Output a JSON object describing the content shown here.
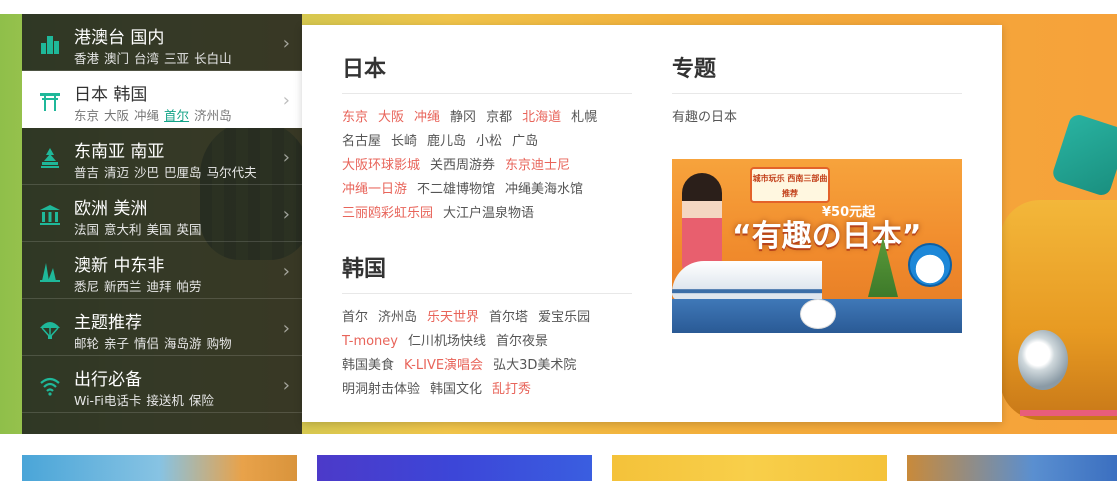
{
  "nav": {
    "items": [
      {
        "title": "港澳台 国内",
        "subs": [
          "香港",
          "澳门",
          "台湾",
          "三亚",
          "长白山"
        ]
      },
      {
        "title": "日本 韩国",
        "subs": [
          "东京",
          "大阪",
          "冲绳",
          "首尔",
          "济州岛"
        ],
        "active": true,
        "highlight": "首尔"
      },
      {
        "title": "东南亚 南亚",
        "subs": [
          "普吉",
          "清迈",
          "沙巴",
          "巴厘岛",
          "马尔代夫"
        ]
      },
      {
        "title": "欧洲 美洲",
        "subs": [
          "法国",
          "意大利",
          "美国",
          "英国"
        ]
      },
      {
        "title": "澳新 中东非",
        "subs": [
          "悉尼",
          "新西兰",
          "迪拜",
          "帕劳"
        ]
      },
      {
        "title": "主题推荐",
        "subs": [
          "邮轮",
          "亲子",
          "情侣",
          "海岛游",
          "购物"
        ]
      },
      {
        "title": "出行必备",
        "subs": [
          "Wi-Fi电话卡",
          "接送机",
          "保险"
        ]
      }
    ],
    "icons": [
      "building-icon",
      "torii-icon",
      "pagoda-icon",
      "museum-icon",
      "opera-house-icon",
      "parachute-icon",
      "wifi-icon"
    ],
    "arrow": "›"
  },
  "panel": {
    "japan": {
      "title": "日本",
      "rows": [
        [
          {
            "t": "东京",
            "red": true
          },
          {
            "t": "大阪",
            "red": true
          },
          {
            "t": "冲绳",
            "red": true
          },
          {
            "t": "静冈"
          },
          {
            "t": "京都"
          },
          {
            "t": "北海道",
            "red": true
          },
          {
            "t": "札幌"
          }
        ],
        [
          {
            "t": "名古屋"
          },
          {
            "t": "长崎"
          },
          {
            "t": "鹿儿岛"
          },
          {
            "t": "小松"
          },
          {
            "t": "广岛"
          }
        ],
        [
          {
            "t": "大阪环球影城",
            "red": true
          },
          {
            "t": "关西周游券"
          },
          {
            "t": "东京迪士尼",
            "red": true
          }
        ],
        [
          {
            "t": "冲绳一日游",
            "red": true
          },
          {
            "t": "不二雄博物馆"
          },
          {
            "t": "冲绳美海水馆"
          }
        ],
        [
          {
            "t": "三丽鸥彩虹乐园",
            "red": true
          },
          {
            "t": "大江户温泉物语"
          }
        ]
      ]
    },
    "korea": {
      "title": "韩国",
      "rows": [
        [
          {
            "t": "首尔"
          },
          {
            "t": "济州岛"
          },
          {
            "t": "乐天世界",
            "red": true
          },
          {
            "t": "首尔塔"
          },
          {
            "t": "爱宝乐园"
          }
        ],
        [
          {
            "t": "T-money",
            "red": true
          },
          {
            "t": "仁川机场快线"
          },
          {
            "t": "首尔夜景"
          }
        ],
        [
          {
            "t": "韩国美食"
          },
          {
            "t": "K-LIVE演唱会",
            "red": true
          },
          {
            "t": "弘大3D美术院"
          }
        ],
        [
          {
            "t": "明洞射击体验"
          },
          {
            "t": "韩国文化"
          },
          {
            "t": "乱打秀",
            "red": true
          }
        ]
      ]
    },
    "topic": {
      "title": "专题",
      "link": "有趣の日本",
      "promo": {
        "banner": "城市玩乐 西南三部曲推荐",
        "price": "¥50元起",
        "title": "“有趣の日本”"
      }
    }
  },
  "colors": {
    "red_link": "#e8645a",
    "active_highlight": "#13a387",
    "nav_bg": "#1e211e"
  }
}
